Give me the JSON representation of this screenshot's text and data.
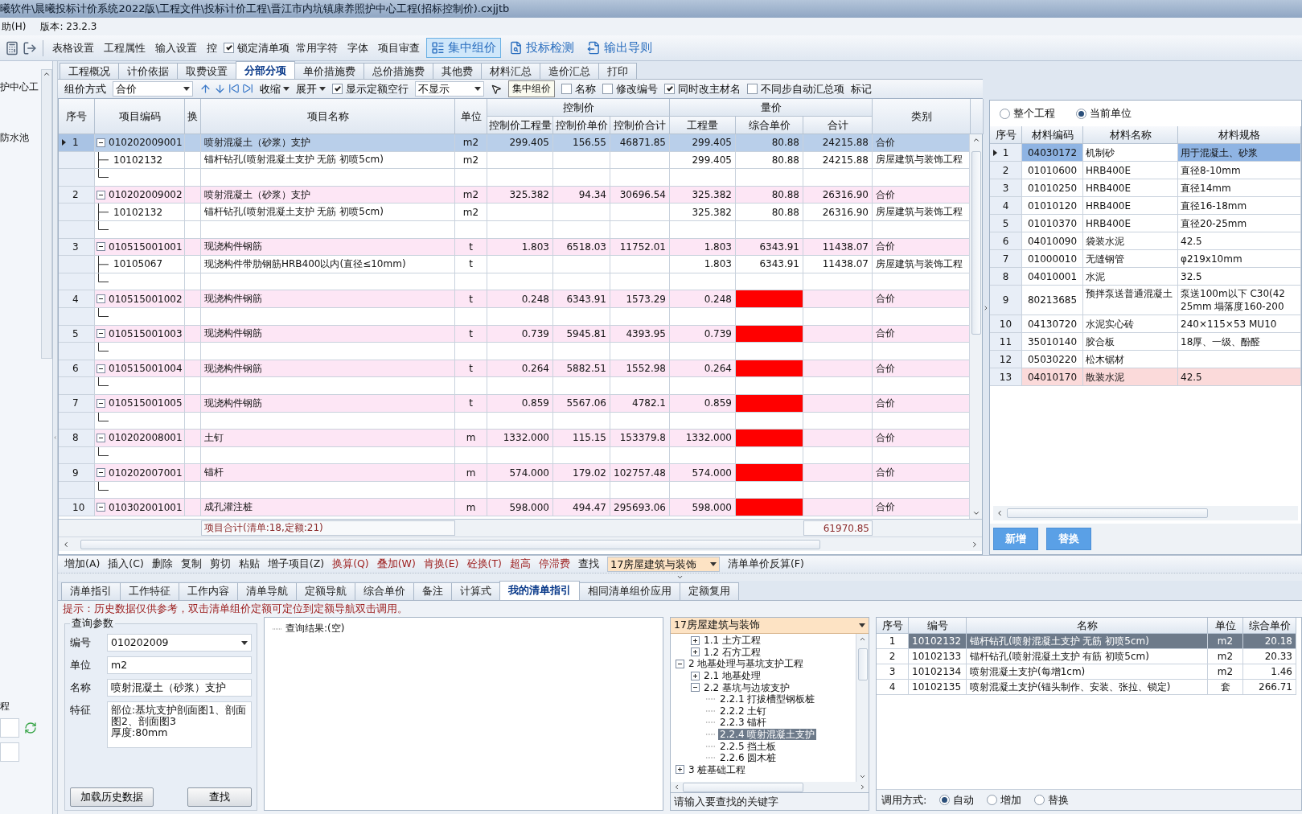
{
  "title_bar": {
    "title": "曦软件\\晨曦投标计价系统2022版\\工程文件\\投标计价工程\\晋江市内坑镇康养照护中心工程(招标控制价).cxjjtb"
  },
  "menu": {
    "items": [
      "助(H)"
    ],
    "version": "版本: 23.2.3"
  },
  "toolbar": {
    "items": [
      {
        "kind": "button",
        "label": "表格设置"
      },
      {
        "kind": "button",
        "label": "工程属性"
      },
      {
        "kind": "button",
        "label": "输入设置"
      },
      {
        "kind": "button",
        "label": "控"
      },
      {
        "kind": "check",
        "label": "锁定清单项",
        "checked": true
      },
      {
        "kind": "button",
        "label": "常用字符"
      },
      {
        "kind": "button",
        "label": "字体"
      },
      {
        "kind": "button",
        "label": "项目审查"
      },
      {
        "kind": "large",
        "label": "集中组价",
        "selected": true
      },
      {
        "kind": "large",
        "label": "投标检测",
        "selected": false
      },
      {
        "kind": "large",
        "label": "输出导则",
        "selected": false
      }
    ]
  },
  "sidebar": {
    "items": [
      "护中心工",
      "防水池"
    ],
    "footer": "程"
  },
  "tabs": [
    {
      "label": "工程概况",
      "selected": false
    },
    {
      "label": "计价依据",
      "selected": false
    },
    {
      "label": "取费设置",
      "selected": false
    },
    {
      "label": "分部分项",
      "selected": true
    },
    {
      "label": "单价措施费",
      "selected": false
    },
    {
      "label": "总价措施费",
      "selected": false
    },
    {
      "label": "其他费",
      "selected": false
    },
    {
      "label": "材料汇总",
      "selected": false
    },
    {
      "label": "造价汇总",
      "selected": false
    },
    {
      "label": "打印",
      "selected": false
    }
  ],
  "tooltip": {
    "text": "集中组价"
  },
  "grid_toolbar": {
    "items": [
      {
        "kind": "label",
        "text": "组价方式"
      },
      {
        "kind": "select",
        "text": "合价"
      },
      {
        "kind": "nav"
      },
      {
        "kind": "menu",
        "text": "收缩"
      },
      {
        "kind": "menu",
        "text": "展开"
      },
      {
        "kind": "check",
        "text": "显示定额空行",
        "checked": true
      },
      {
        "kind": "select",
        "text": "不显示"
      },
      {
        "kind": "check",
        "text": "名称",
        "checked": false
      },
      {
        "kind": "check",
        "text": "修改编号",
        "checked": false
      },
      {
        "kind": "check",
        "text": "同时改主材名",
        "checked": true
      },
      {
        "kind": "check",
        "text": "不同步自动汇总项",
        "checked": false
      },
      {
        "kind": "label",
        "text": "标记"
      }
    ]
  },
  "main_table": {
    "header_groups": {
      "control": "控制价",
      "quantity": "量价"
    },
    "columns": [
      "序号",
      "项目编码",
      "换",
      "项目名称",
      "单位",
      "控制价工程量",
      "控制价单价",
      "控制价合计",
      "工程量",
      "综合单价",
      "合计",
      "类别"
    ],
    "rows": [
      {
        "seq": "1",
        "code": "010202009001",
        "name": "喷射混凝土（砂浆）支护",
        "unit": "m2",
        "ctrl_qty": "299.405",
        "ctrl_price": "156.55",
        "ctrl_total": "46871.85",
        "qty": "299.405",
        "price": "80.88",
        "total": "24215.88",
        "category": "合价",
        "selected": true,
        "expanded": true,
        "price_missing": false,
        "children": [
          {
            "code": "10102132",
            "name": "锚杆钻孔(喷射混凝土支护 无筋 初喷5cm)",
            "unit": "m2",
            "qty": "299.405",
            "price": "80.88",
            "total": "24215.88",
            "category": "房屋建筑与装饰工程"
          }
        ]
      },
      {
        "seq": "2",
        "code": "010202009002",
        "name": "喷射混凝土（砂浆）支护",
        "unit": "m2",
        "ctrl_qty": "325.382",
        "ctrl_price": "94.34",
        "ctrl_total": "30696.54",
        "qty": "325.382",
        "price": "80.88",
        "total": "26316.90",
        "category": "合价",
        "selected": false,
        "expanded": true,
        "price_missing": false,
        "children": [
          {
            "code": "10102132",
            "name": "锚杆钻孔(喷射混凝土支护 无筋 初喷5cm)",
            "unit": "m2",
            "qty": "325.382",
            "price": "80.88",
            "total": "26316.90",
            "category": "房屋建筑与装饰工程"
          }
        ]
      },
      {
        "seq": "3",
        "code": "010515001001",
        "name": "现浇构件钢筋",
        "unit": "t",
        "ctrl_qty": "1.803",
        "ctrl_price": "6518.03",
        "ctrl_total": "11752.01",
        "qty": "1.803",
        "price": "6343.91",
        "total": "11438.07",
        "category": "合价",
        "selected": false,
        "expanded": true,
        "price_missing": false,
        "children": [
          {
            "code": "10105067",
            "name": "现浇构件带肋钢筋HRB400以内(直径≤10mm)",
            "unit": "t",
            "qty": "1.803",
            "price": "6343.91",
            "total": "11438.07",
            "category": "房屋建筑与装饰工程"
          }
        ]
      },
      {
        "seq": "4",
        "code": "010515001002",
        "name": "现浇构件钢筋",
        "unit": "t",
        "ctrl_qty": "0.248",
        "ctrl_price": "6343.91",
        "ctrl_total": "1573.29",
        "qty": "0.248",
        "category": "合价",
        "selected": false,
        "expanded": true,
        "price_missing": true
      },
      {
        "seq": "5",
        "code": "010515001003",
        "name": "现浇构件钢筋",
        "unit": "t",
        "ctrl_qty": "0.739",
        "ctrl_price": "5945.81",
        "ctrl_total": "4393.95",
        "qty": "0.739",
        "category": "合价",
        "selected": false,
        "expanded": true,
        "price_missing": true
      },
      {
        "seq": "6",
        "code": "010515001004",
        "name": "现浇构件钢筋",
        "unit": "t",
        "ctrl_qty": "0.264",
        "ctrl_price": "5882.51",
        "ctrl_total": "1552.98",
        "qty": "0.264",
        "category": "合价",
        "selected": false,
        "expanded": true,
        "price_missing": true
      },
      {
        "seq": "7",
        "code": "010515001005",
        "name": "现浇构件钢筋",
        "unit": "t",
        "ctrl_qty": "0.859",
        "ctrl_price": "5567.06",
        "ctrl_total": "4782.1",
        "qty": "0.859",
        "category": "合价",
        "selected": false,
        "expanded": true,
        "price_missing": true
      },
      {
        "seq": "8",
        "code": "010202008001",
        "name": "土钉",
        "unit": "m",
        "ctrl_qty": "1332.000",
        "ctrl_price": "115.15",
        "ctrl_total": "153379.8",
        "qty": "1332.000",
        "category": "合价",
        "selected": false,
        "expanded": true,
        "price_missing": true
      },
      {
        "seq": "9",
        "code": "010202007001",
        "name": "锚杆",
        "unit": "m",
        "ctrl_qty": "574.000",
        "ctrl_price": "179.02",
        "ctrl_total": "102757.48",
        "qty": "574.000",
        "category": "合价",
        "selected": false,
        "expanded": true,
        "price_missing": true
      },
      {
        "seq": "10",
        "code": "010302001001",
        "name": "成孔灌注桩",
        "unit": "m",
        "ctrl_qty": "598.000",
        "ctrl_price": "494.47",
        "ctrl_total": "295693.06",
        "qty": "598.000",
        "category": "合价",
        "selected": false,
        "expanded": true,
        "price_missing": true
      }
    ],
    "footer": {
      "count": "项目合计(清单:18,定额:21)",
      "total": "61970.85"
    }
  },
  "material_panel": {
    "scope": [
      {
        "label": "整个工程",
        "selected": false
      },
      {
        "label": "当前单位",
        "selected": true
      }
    ],
    "columns": [
      "序号",
      "材料编码",
      "材料名称",
      "材料规格"
    ],
    "rows": [
      {
        "seq": "1",
        "code": "04030172",
        "name": "机制砂",
        "spec": "用于混凝土、砂浆",
        "selected": true,
        "flagged": false
      },
      {
        "seq": "2",
        "code": "01010600",
        "name": "HRB400E",
        "spec": "直径8-10mm",
        "selected": false,
        "flagged": false
      },
      {
        "seq": "3",
        "code": "01010250",
        "name": "HRB400E",
        "spec": "直径14mm",
        "selected": false,
        "flagged": false
      },
      {
        "seq": "4",
        "code": "01010120",
        "name": "HRB400E",
        "spec": "直径16-18mm",
        "selected": false,
        "flagged": false
      },
      {
        "seq": "5",
        "code": "01010370",
        "name": "HRB400E",
        "spec": "直径20-25mm",
        "selected": false,
        "flagged": false
      },
      {
        "seq": "6",
        "code": "04010090",
        "name": "袋装水泥",
        "spec": "42.5",
        "selected": false,
        "flagged": false
      },
      {
        "seq": "7",
        "code": "01000010",
        "name": "无缝钢管",
        "spec": "φ219x10mm",
        "selected": false,
        "flagged": false
      },
      {
        "seq": "8",
        "code": "04010001",
        "name": "水泥",
        "spec": "32.5",
        "selected": false,
        "flagged": false
      },
      {
        "seq": "9",
        "code": "80213685",
        "name": "预拌泵送普通混凝土",
        "spec": "泵送100m以下 C30(42\n25mm 塌落度160-200",
        "selected": false,
        "flagged": false
      },
      {
        "seq": "10",
        "code": "04130720",
        "name": "水泥实心砖",
        "spec": "240×115×53 MU10",
        "selected": false,
        "flagged": false
      },
      {
        "seq": "11",
        "code": "35010140",
        "name": "胶合板",
        "spec": "18厚、一级、酚醛",
        "selected": false,
        "flagged": false
      },
      {
        "seq": "12",
        "code": "05030220",
        "name": "松木锯材",
        "selected": false,
        "flagged": false
      },
      {
        "seq": "13",
        "code": "04010170",
        "name": "散装水泥",
        "spec": "42.5",
        "selected": false,
        "flagged": true
      }
    ],
    "buttons": [
      "新增",
      "替换"
    ]
  },
  "bottom_toolbar": {
    "items": [
      {
        "kind": "action",
        "label": "增加(A)"
      },
      {
        "kind": "action",
        "label": "插入(C)"
      },
      {
        "kind": "action",
        "label": "删除"
      },
      {
        "kind": "action",
        "label": "复制"
      },
      {
        "kind": "action",
        "label": "剪切"
      },
      {
        "kind": "action",
        "label": "粘贴"
      },
      {
        "kind": "action",
        "label": "增子项目(Z)"
      },
      {
        "kind": "convert",
        "label": "换算(Q)"
      },
      {
        "kind": "convert",
        "label": "叠加(W)"
      },
      {
        "kind": "convert",
        "label": "肯换(E)"
      },
      {
        "kind": "convert",
        "label": "砼换(T)"
      },
      {
        "kind": "convert",
        "label": "超高"
      },
      {
        "kind": "convert",
        "label": "停滞费"
      },
      {
        "kind": "action",
        "label": "查找"
      },
      {
        "kind": "select",
        "label": "17房屋建筑与装饰"
      },
      {
        "kind": "action",
        "label": "清单单价反算(F)"
      }
    ]
  },
  "bottom_tabs": [
    {
      "label": "清单指引",
      "selected": false
    },
    {
      "label": "工作特征",
      "selected": false
    },
    {
      "label": "工作内容",
      "selected": false
    },
    {
      "label": "清单导航",
      "selected": false
    },
    {
      "label": "定额导航",
      "selected": false
    },
    {
      "label": "综合单价",
      "selected": false
    },
    {
      "label": "备注",
      "selected": false
    },
    {
      "label": "计算式",
      "selected": false
    },
    {
      "label": "我的清单指引",
      "selected": true
    },
    {
      "label": "相同清单组价应用",
      "selected": false
    },
    {
      "label": "定额复用",
      "selected": false
    }
  ],
  "hint": "提示：历史数据仅供参考，双击清单组价定额可定位到定额导航双击调用。",
  "query": {
    "title": "查询参数",
    "fields": [
      {
        "kind": "combo",
        "label": "编号",
        "value": "010202009"
      },
      {
        "kind": "text",
        "label": "单位",
        "value": "m2"
      },
      {
        "kind": "text",
        "label": "名称",
        "value": "喷射混凝土（砂浆）支护"
      },
      {
        "kind": "area",
        "label": "特征",
        "value": "部位:基坑支护剖面图1、剖面图2、剖面图3\n厚度:80mm"
      }
    ],
    "buttons": [
      "加载历史数据",
      "查找"
    ]
  },
  "result": {
    "root": "查询结果:(空)"
  },
  "tree_panel": {
    "library": "17房屋建筑与装饰",
    "continued": [
      {
        "label": "1.1 土方工程",
        "expanded": false
      },
      {
        "label": "1.2 石方工程",
        "expanded": false
      }
    ],
    "nodes": [
      {
        "label": "2 地基处理与基坑支护工程",
        "expanded": true,
        "children": [
          {
            "label": "2.1 地基处理",
            "expanded": false
          },
          {
            "label": "2.2 基坑与边坡支护",
            "expanded": true,
            "children": [
              {
                "label": "2.2.1 打拔槽型钢板桩",
                "selected": false
              },
              {
                "label": "2.2.2 土钉",
                "selected": false
              },
              {
                "label": "2.2.3 锚杆",
                "selected": false
              },
              {
                "label": "2.2.4 喷射混凝土支护",
                "selected": true
              },
              {
                "label": "2.2.5 挡土板",
                "selected": false
              },
              {
                "label": "2.2.6 圆木桩",
                "selected": false
              }
            ]
          }
        ]
      },
      {
        "label": "3 桩基础工程",
        "expanded": false
      }
    ],
    "search": {
      "placeholder": "请输入要查找的关键字"
    }
  },
  "quota_table": {
    "columns": [
      "序号",
      "编号",
      "名称",
      "单位",
      "综合单价"
    ],
    "rows": [
      {
        "seq": "1",
        "code": "10102132",
        "name": "锚杆钻孔(喷射混凝土支护 无筋 初喷5cm)",
        "unit": "m2",
        "price": "20.18",
        "selected": true
      },
      {
        "seq": "2",
        "code": "10102133",
        "name": "锚杆钻孔(喷射混凝土支护 有筋 初喷5cm)",
        "unit": "m2",
        "price": "20.33",
        "selected": false
      },
      {
        "seq": "3",
        "code": "10102134",
        "name": "喷射混凝土支护(每增1cm)",
        "unit": "m2",
        "price": "1.46",
        "selected": false
      },
      {
        "seq": "4",
        "code": "10102135",
        "name": "喷射混凝土支护(锚头制作、安装、张拉、锁定)",
        "unit": "套",
        "price": "266.71",
        "selected": false
      }
    ]
  },
  "call_mode": {
    "label": "调用方式:",
    "options": [
      {
        "label": "自动",
        "selected": true
      },
      {
        "label": "增加",
        "selected": false
      },
      {
        "label": "替换",
        "selected": false
      }
    ]
  }
}
